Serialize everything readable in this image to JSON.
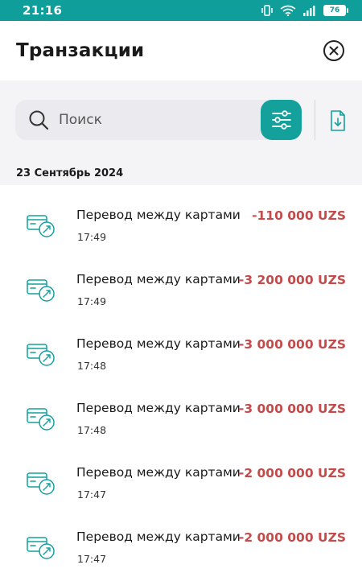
{
  "status_bar": {
    "time": "21:16",
    "battery": "76",
    "icons": [
      "vibrate-icon",
      "wifi-icon",
      "signal-icon",
      "battery-icon"
    ]
  },
  "header": {
    "title": "Транзакции",
    "close_icon": "close-circle-icon"
  },
  "search": {
    "placeholder": "Поиск",
    "value": "",
    "filter_icon": "sliders-icon",
    "download_icon": "download-file-icon"
  },
  "groups": [
    {
      "date": "23 Сентябрь 2024",
      "transactions": [
        {
          "title": "Перевод между картами",
          "time": "17:49",
          "amount": "-110 000 UZS"
        },
        {
          "title": "Перевод между картами",
          "time": "17:49",
          "amount": "-3 200 000 UZS"
        },
        {
          "title": "Перевод между картами",
          "time": "17:48",
          "amount": "-3 000 000 UZS"
        },
        {
          "title": "Перевод между картами",
          "time": "17:48",
          "amount": "-3 000 000 UZS"
        },
        {
          "title": "Перевод между картами",
          "time": "17:47",
          "amount": "-2 000 000 UZS"
        },
        {
          "title": "Перевод между картами",
          "time": "17:47",
          "amount": "-2 000 000 UZS"
        }
      ]
    }
  ],
  "colors": {
    "accent": "#14a19c",
    "status_bar": "#0f9e9a",
    "negative_amount": "#c54a4a",
    "section_bg": "#f4f4f6"
  }
}
